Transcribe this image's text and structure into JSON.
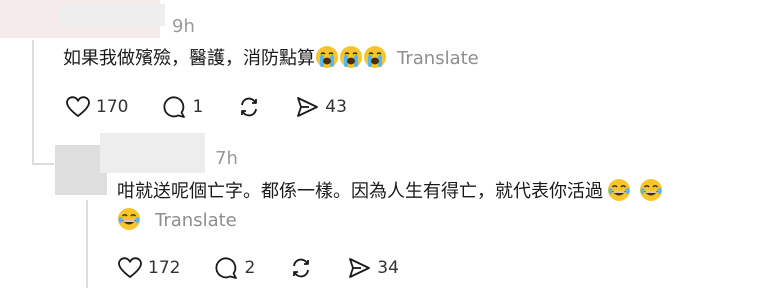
{
  "comments": [
    {
      "time": "9h",
      "text": "如果我做殯殮，醫護，消防點算",
      "emojis": [
        "sob-emoji",
        "sob-emoji",
        "sob-emoji"
      ],
      "translate": "Translate",
      "likes": "170",
      "replies": "1",
      "shares": "43"
    },
    {
      "time": "7h",
      "text_line1": "咁就送呢個亡字。都係一樣。因為人生有得亡，就代表你活過",
      "emojis_line1": [
        "joy-emoji",
        "joy-emoji"
      ],
      "emojis_line2": [
        "joy-emoji"
      ],
      "translate": "Translate",
      "likes": "172",
      "replies": "2",
      "shares": "34"
    }
  ],
  "colors": {
    "text": "#1a1a1a",
    "muted": "#999999",
    "translate": "#8e8e8e",
    "emoji_face": "#f5c52a"
  }
}
